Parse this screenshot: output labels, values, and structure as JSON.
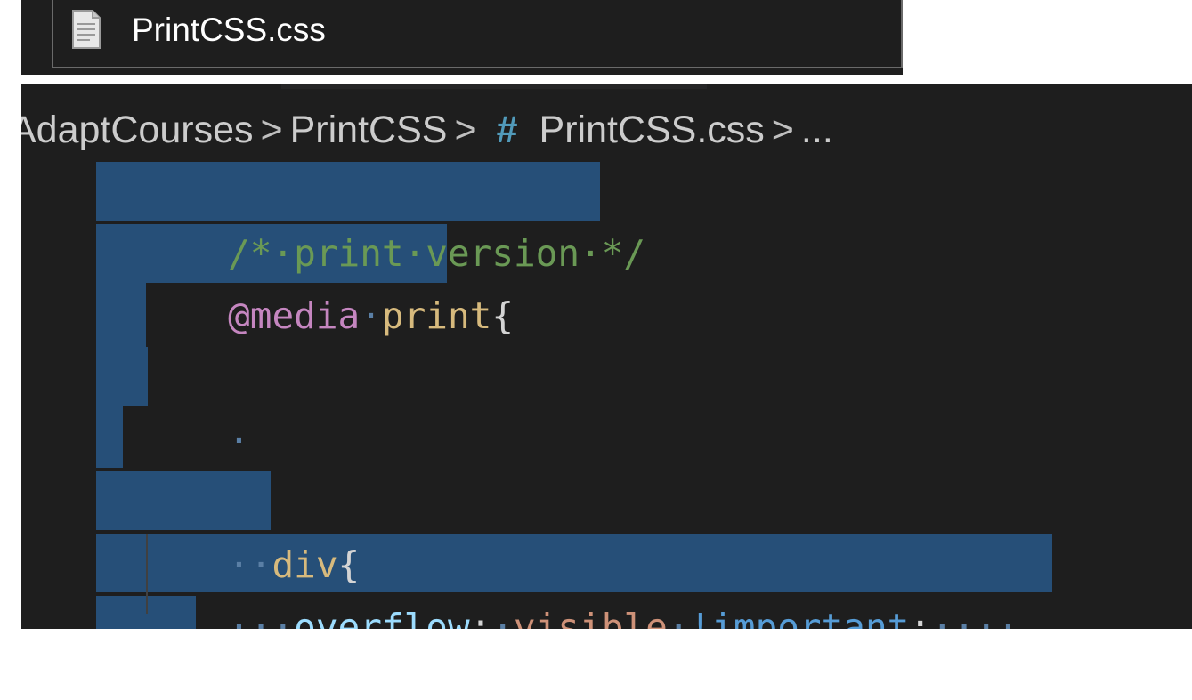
{
  "explorer": {
    "file_name": "PrintCSS.css",
    "file_icon": "file-icon"
  },
  "breadcrumb": {
    "folder_1": "AdaptCourses",
    "folder_2": "PrintCSS",
    "file_symbol": "#",
    "file": "PrintCSS.css",
    "more": "...",
    "separator": ">"
  },
  "code": {
    "comment": "/*·print·version·*/",
    "at_rule": "@media",
    "media_type": "print",
    "open_brace": "{",
    "blank_marker": "·",
    "indent_2": "··",
    "selector": "div",
    "indent_4": "···",
    "property": "overflow",
    "colon": ":",
    "value": "visible",
    "important": "!important",
    "semicolon": ";",
    "trailing_ws": "····",
    "close_brace": "}"
  },
  "colors": {
    "editor_bg": "#1e1e1e",
    "selection": "#264f78",
    "comment": "#6a9955",
    "at_rule": "#c586c0",
    "selector": "#d7ba7d",
    "property": "#9cdcfe",
    "value": "#ce9178",
    "important": "#569cd6"
  }
}
